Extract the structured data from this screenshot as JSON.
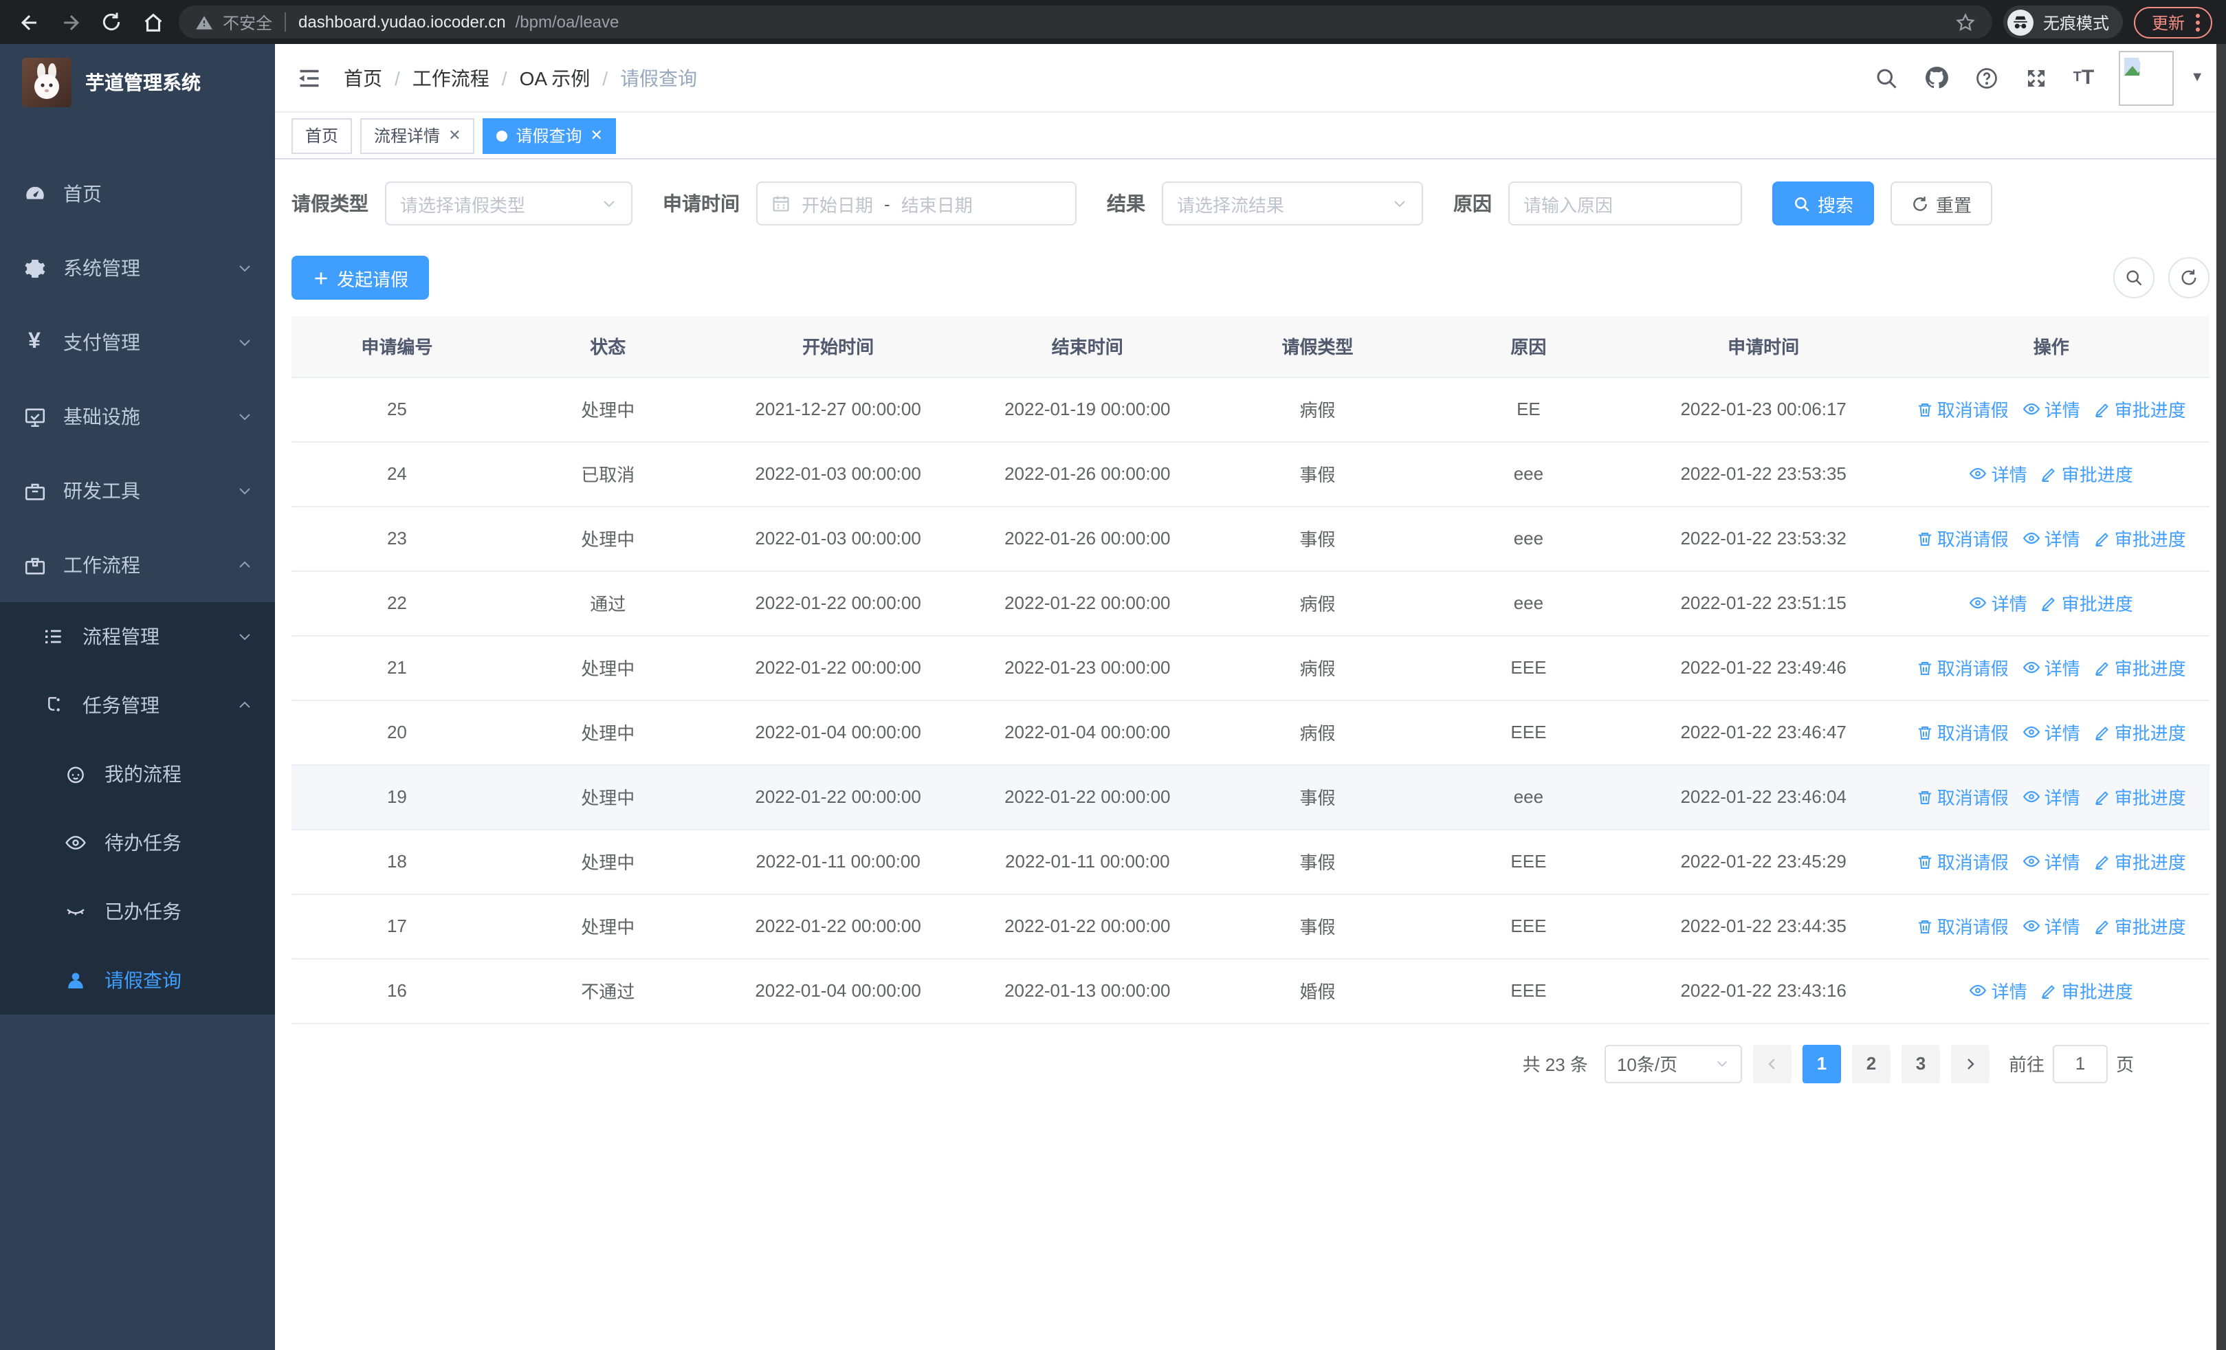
{
  "colors": {
    "accent": "#409eff",
    "sidebar_bg": "#304156",
    "submenu_bg": "#1f2d3d",
    "chrome_bg": "#1f2023"
  },
  "browser": {
    "security_text": "不安全",
    "url_host": "dashboard.yudao.iocoder.cn",
    "url_path": "/bpm/oa/leave",
    "incognito_label": "无痕模式",
    "update_label": "更新"
  },
  "sidebar": {
    "title": "芋道管理系统",
    "items": [
      {
        "label": "首页",
        "icon": "dashboard-icon"
      },
      {
        "label": "系统管理",
        "icon": "gear-icon"
      },
      {
        "label": "支付管理",
        "icon": "yen-icon"
      },
      {
        "label": "基础设施",
        "icon": "monitor-icon"
      },
      {
        "label": "研发工具",
        "icon": "toolbox-icon"
      },
      {
        "label": "工作流程",
        "icon": "briefcase-icon",
        "children": [
          {
            "label": "流程管理",
            "icon": "list-icon"
          },
          {
            "label": "任务管理",
            "icon": "flow-icon",
            "children": [
              {
                "label": "我的流程",
                "icon": "face-icon"
              },
              {
                "label": "待办任务",
                "icon": "eye-icon"
              },
              {
                "label": "已办任务",
                "icon": "eye-closed-icon"
              },
              {
                "label": "请假查询",
                "icon": "user-icon",
                "active": true
              }
            ]
          }
        ]
      }
    ]
  },
  "header": {
    "breadcrumb": [
      "首页",
      "工作流程",
      "OA 示例",
      "请假查询"
    ]
  },
  "tabs": [
    {
      "label": "首页",
      "closable": false,
      "active": false
    },
    {
      "label": "流程详情",
      "closable": true,
      "active": false
    },
    {
      "label": "请假查询",
      "closable": true,
      "active": true
    }
  ],
  "filters": {
    "leave_type": {
      "label": "请假类型",
      "placeholder": "请选择请假类型"
    },
    "apply_time": {
      "label": "申请时间",
      "start_placeholder": "开始日期",
      "separator": "-",
      "end_placeholder": "结束日期"
    },
    "result": {
      "label": "结果",
      "placeholder": "请选择流结果"
    },
    "reason": {
      "label": "原因",
      "placeholder": "请输入原因"
    },
    "search_label": "搜索",
    "reset_label": "重置"
  },
  "toolbar": {
    "create_label": "发起请假"
  },
  "table": {
    "columns": [
      "申请编号",
      "状态",
      "开始时间",
      "结束时间",
      "请假类型",
      "原因",
      "申请时间",
      "操作"
    ],
    "action_labels": {
      "cancel": "取消请假",
      "detail": "详情",
      "progress": "审批进度"
    },
    "rows": [
      {
        "id": "25",
        "status": "处理中",
        "start": "2021-12-27 00:00:00",
        "end": "2022-01-19 00:00:00",
        "type": "病假",
        "reason": "EE",
        "apply_time": "2022-01-23 00:06:17",
        "cancellable": true,
        "hover": false
      },
      {
        "id": "24",
        "status": "已取消",
        "start": "2022-01-03 00:00:00",
        "end": "2022-01-26 00:00:00",
        "type": "事假",
        "reason": "eee",
        "apply_time": "2022-01-22 23:53:35",
        "cancellable": false,
        "hover": false
      },
      {
        "id": "23",
        "status": "处理中",
        "start": "2022-01-03 00:00:00",
        "end": "2022-01-26 00:00:00",
        "type": "事假",
        "reason": "eee",
        "apply_time": "2022-01-22 23:53:32",
        "cancellable": true,
        "hover": false
      },
      {
        "id": "22",
        "status": "通过",
        "start": "2022-01-22 00:00:00",
        "end": "2022-01-22 00:00:00",
        "type": "病假",
        "reason": "eee",
        "apply_time": "2022-01-22 23:51:15",
        "cancellable": false,
        "hover": false
      },
      {
        "id": "21",
        "status": "处理中",
        "start": "2022-01-22 00:00:00",
        "end": "2022-01-23 00:00:00",
        "type": "病假",
        "reason": "EEE",
        "apply_time": "2022-01-22 23:49:46",
        "cancellable": true,
        "hover": false
      },
      {
        "id": "20",
        "status": "处理中",
        "start": "2022-01-04 00:00:00",
        "end": "2022-01-04 00:00:00",
        "type": "病假",
        "reason": "EEE",
        "apply_time": "2022-01-22 23:46:47",
        "cancellable": true,
        "hover": false
      },
      {
        "id": "19",
        "status": "处理中",
        "start": "2022-01-22 00:00:00",
        "end": "2022-01-22 00:00:00",
        "type": "事假",
        "reason": "eee",
        "apply_time": "2022-01-22 23:46:04",
        "cancellable": true,
        "hover": true
      },
      {
        "id": "18",
        "status": "处理中",
        "start": "2022-01-11 00:00:00",
        "end": "2022-01-11 00:00:00",
        "type": "事假",
        "reason": "EEE",
        "apply_time": "2022-01-22 23:45:29",
        "cancellable": true,
        "hover": false
      },
      {
        "id": "17",
        "status": "处理中",
        "start": "2022-01-22 00:00:00",
        "end": "2022-01-22 00:00:00",
        "type": "事假",
        "reason": "EEE",
        "apply_time": "2022-01-22 23:44:35",
        "cancellable": true,
        "hover": false
      },
      {
        "id": "16",
        "status": "不通过",
        "start": "2022-01-04 00:00:00",
        "end": "2022-01-13 00:00:00",
        "type": "婚假",
        "reason": "EEE",
        "apply_time": "2022-01-22 23:43:16",
        "cancellable": false,
        "hover": false
      }
    ]
  },
  "pagination": {
    "total_text": "共 23 条",
    "page_size": "10条/页",
    "pages": [
      "1",
      "2",
      "3"
    ],
    "active_page": "1",
    "goto_label": "前往",
    "goto_value": "1",
    "page_unit": "页"
  }
}
